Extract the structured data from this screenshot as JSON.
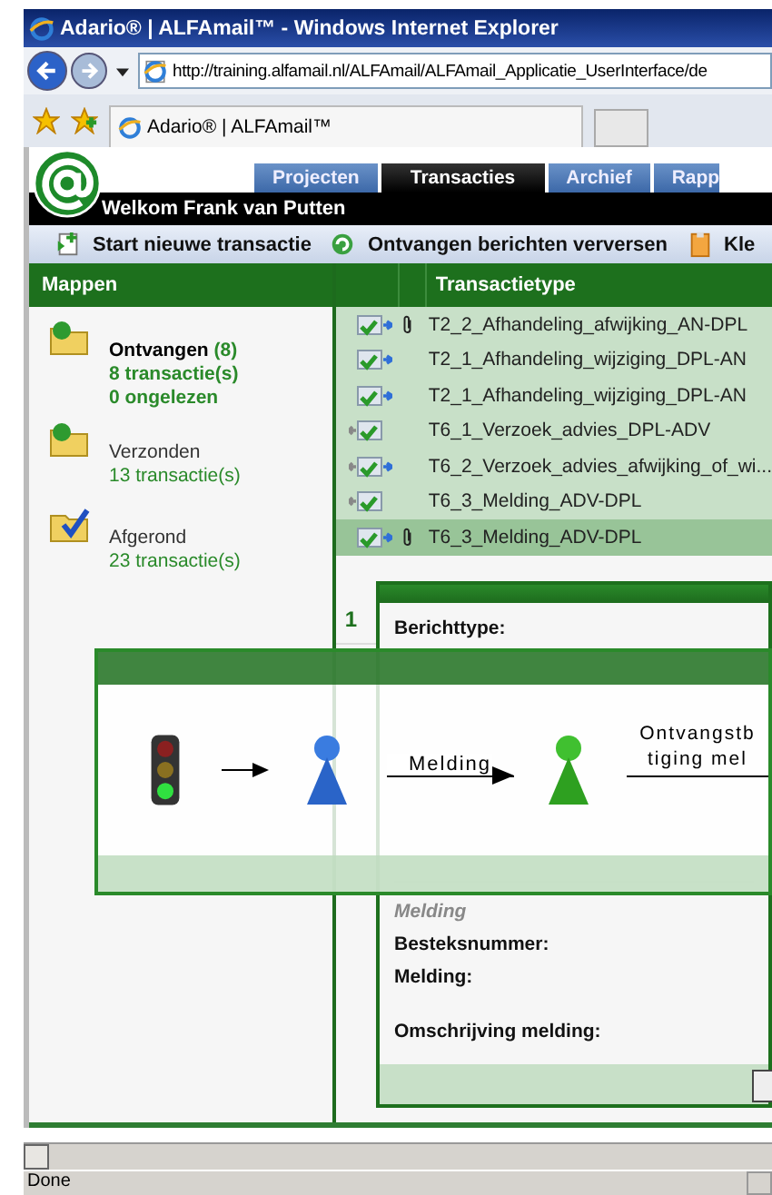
{
  "browser": {
    "title": "Adario® | ALFAmail™ - Windows Internet Explorer",
    "address": "http://training.alfamail.nl/ALFAmail/ALFAmail_Applicatie_UserInterface/de",
    "tab": "Adario® | ALFAmail™",
    "status": "Done"
  },
  "nav_tabs": [
    {
      "label": "Projecten",
      "selected": false
    },
    {
      "label": "Transacties",
      "selected": true
    },
    {
      "label": "Archief",
      "selected": false
    },
    {
      "label": "Rapp",
      "selected": false
    }
  ],
  "welcome": "Welkom Frank van Putten",
  "toolbar": [
    {
      "label": "Start nieuwe transactie",
      "kind": "new"
    },
    {
      "label": "Ontvangen berichten verversen",
      "kind": "refresh"
    },
    {
      "label": "Kle",
      "kind": "clipboard"
    }
  ],
  "folders": {
    "title": "Mappen",
    "items": [
      {
        "name": "Ontvangen",
        "count": "(8)",
        "lines": [
          "8 transactie(s)",
          "0 ongelezen"
        ],
        "selected": true,
        "kind": "inbox"
      },
      {
        "name": "Verzonden",
        "lines": [
          "13 transactie(s)"
        ],
        "selected": false,
        "kind": "sent"
      },
      {
        "name": "Afgerond",
        "lines": [
          "23 transactie(s)"
        ],
        "selected": false,
        "kind": "done"
      }
    ]
  },
  "list": {
    "column": "Transactietype",
    "rows": [
      {
        "type": "T2_2_Afhandeling_afwijking_AN-DPL",
        "kind": "in",
        "attachment": true,
        "selected": false
      },
      {
        "type": "T2_1_Afhandeling_wijziging_DPL-AN",
        "kind": "in",
        "attachment": false,
        "selected": false
      },
      {
        "type": "T2_1_Afhandeling_wijziging_DPL-AN",
        "kind": "in",
        "attachment": false,
        "selected": false
      },
      {
        "type": "T6_1_Verzoek_advies_DPL-ADV",
        "kind": "out",
        "attachment": false,
        "selected": false
      },
      {
        "type": "T6_2_Verzoek_advies_afwijking_of_wi...",
        "kind": "both",
        "attachment": false,
        "selected": false
      },
      {
        "type": "T6_3_Melding_ADV-DPL",
        "kind": "out",
        "attachment": false,
        "selected": false
      },
      {
        "type": "T6_3_Melding_ADV-DPL",
        "kind": "in",
        "attachment": true,
        "selected": true
      }
    ],
    "page": "1"
  },
  "detail": {
    "fields": [
      "Berichttype:"
    ],
    "section": "Melding",
    "section_fields": [
      "Besteksnummer:",
      "Melding:",
      "Omschrijving melding:"
    ]
  },
  "flow": {
    "message": "Melding",
    "reply": [
      "Ontvangstb",
      "tiging mel"
    ]
  }
}
